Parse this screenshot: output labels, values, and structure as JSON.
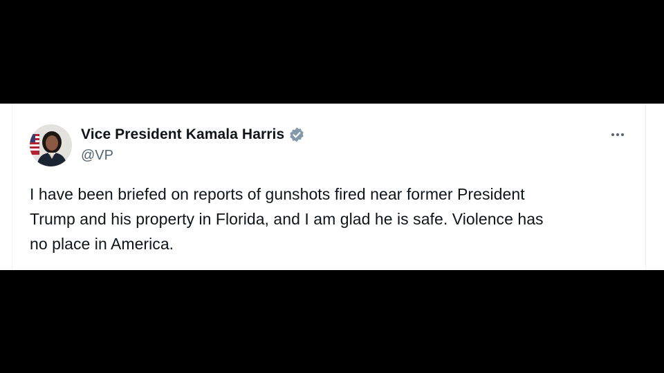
{
  "tweet": {
    "author": {
      "display_name": "Vice President Kamala Harris",
      "handle": "@VP",
      "verified_badge_icon": "verified-badge-icon",
      "verified_badge_color": "#829aab",
      "avatar_icon": "avatar-portrait"
    },
    "more_menu_icon": "more-horizontal-icon",
    "text_lines": [
      "I have been briefed on reports of gunshots fired near former President",
      "Trump and his property in Florida, and I am glad he is safe. Violence has",
      "no place in America."
    ]
  },
  "colors": {
    "letterbox": "#000000",
    "card_background": "#ffffff",
    "primary_text": "#0f1419",
    "secondary_text": "#536471"
  }
}
